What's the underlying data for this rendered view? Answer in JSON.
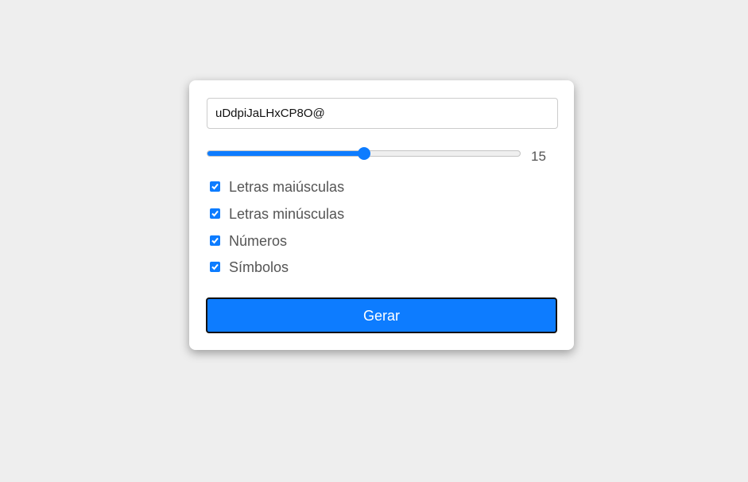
{
  "password": {
    "value": "uDdpiJaLHxCP8O@"
  },
  "length": {
    "value": "15",
    "fraction": 0.5
  },
  "options": [
    {
      "label": "Letras maiúsculas",
      "checked": true
    },
    {
      "label": "Letras minúsculas",
      "checked": true
    },
    {
      "label": "Números",
      "checked": true
    },
    {
      "label": "Símbolos",
      "checked": true
    }
  ],
  "generate_button": {
    "label": "Gerar"
  },
  "colors": {
    "accent": "#0d7cff",
    "background": "#eeeeee",
    "card": "#ffffff"
  }
}
